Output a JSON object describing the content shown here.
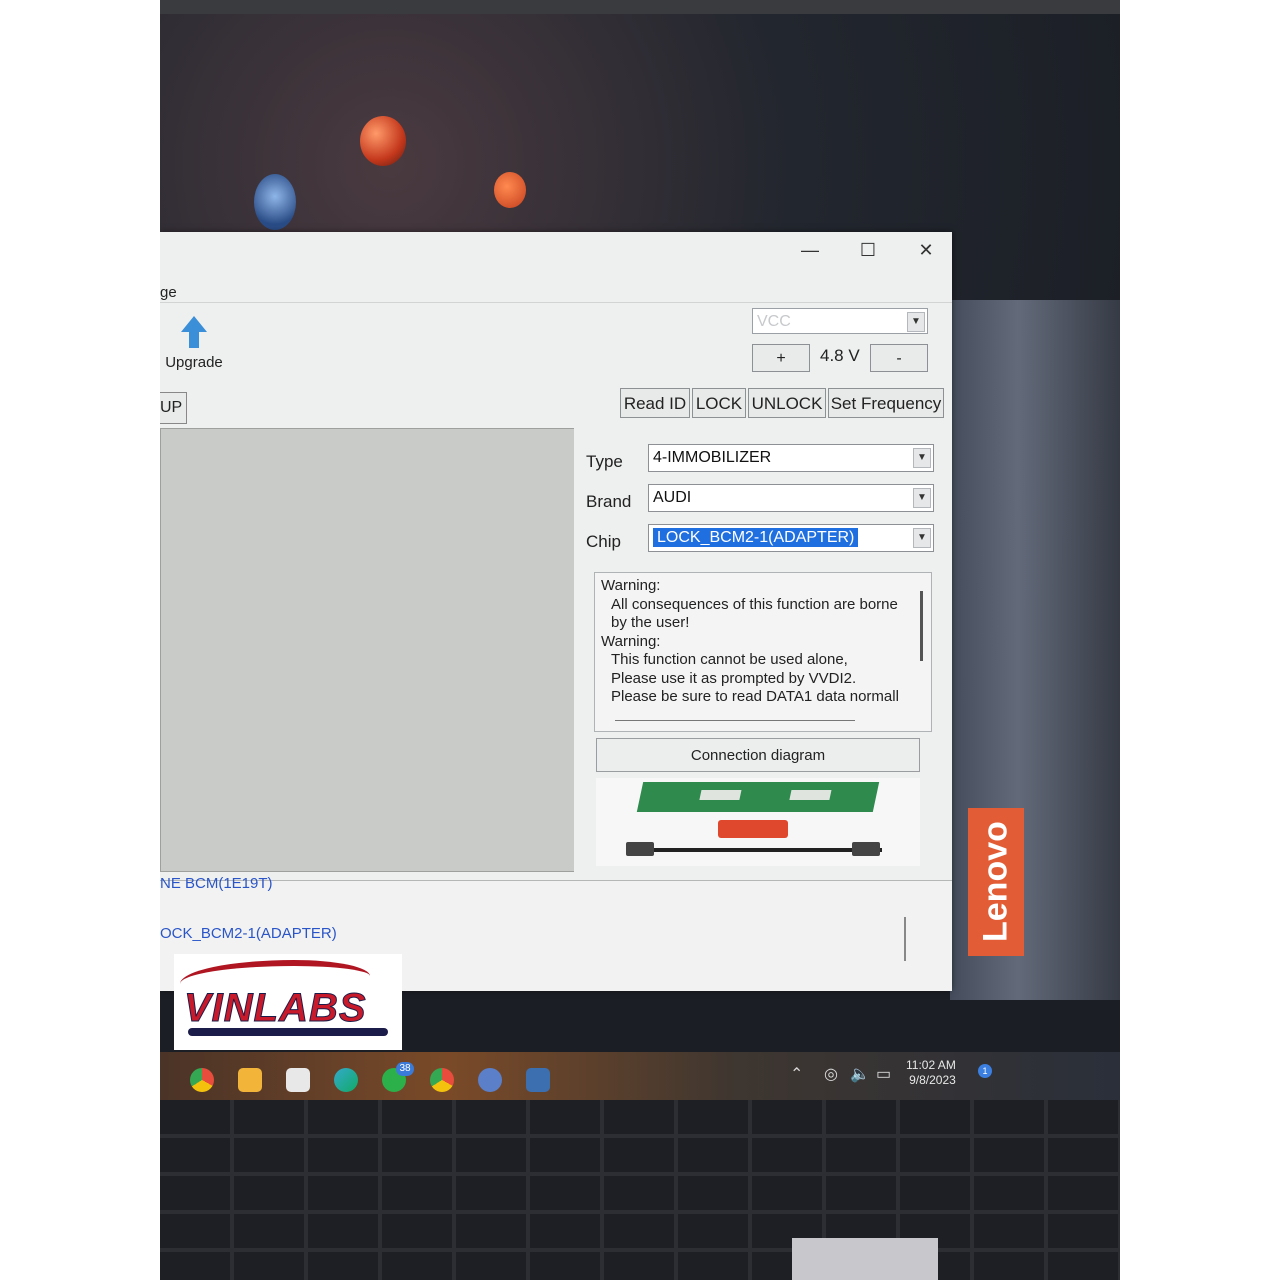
{
  "window": {
    "menu_fragment": "ge",
    "controls": {
      "minimize": "—",
      "maximize": "☐",
      "close": "✕"
    }
  },
  "toolbar": {
    "upgrade_label": "Upgrade",
    "vcc_placeholder": "VCC",
    "plus_label": "+",
    "voltage": "4.8 V",
    "minus_label": "-"
  },
  "tab_fragment": "UP",
  "function_buttons": {
    "read_id": "Read ID",
    "lock": "LOCK",
    "unlock": "UNLOCK",
    "set_frequency": "Set Frequency"
  },
  "form": {
    "type_label": "Type",
    "type_value": "4-IMMOBILIZER",
    "brand_label": "Brand",
    "brand_value": "AUDI",
    "chip_label": "Chip",
    "chip_value": "LOCK_BCM2-1(ADAPTER)"
  },
  "warning": {
    "line1": "Warning:",
    "line2": "All consequences of this function are borne",
    "line3": "by the user!",
    "line4": "Warning:",
    "line5": "This function cannot be used alone,",
    "line6": "Please use it as prompted by VVDI2.",
    "line7": "Please be sure to read DATA1 data normall"
  },
  "connection_button": "Connection diagram",
  "log": {
    "line1": "NE BCM(1E19T)",
    "line2": "OCK_BCM2-1(ADAPTER)"
  },
  "watermark": {
    "text": "VINLABS"
  },
  "laptop": {
    "brand": "Lenovo"
  },
  "taskbar": {
    "whatsapp_badge": "38",
    "time": "11:02 AM",
    "date": "9/8/2023",
    "notification_count": "1"
  },
  "colors": {
    "selection": "#1f6fe0",
    "upgrade_icon": "#3b8fd8",
    "log_text": "#2a55c9",
    "lenovo_orange": "#e25c35",
    "watermark_red": "#c81a2a"
  }
}
